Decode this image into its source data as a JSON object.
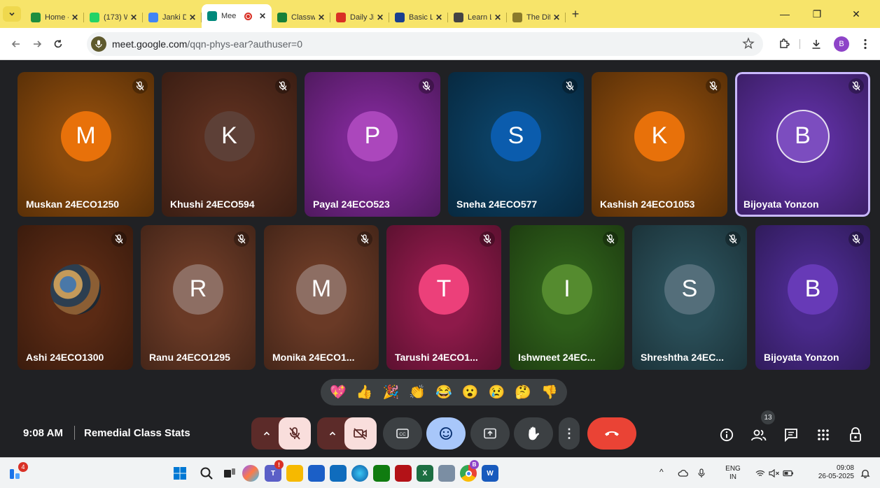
{
  "browser": {
    "tab_search_icon": "chevron-down-icon",
    "tabs": [
      {
        "title": "Home -",
        "icon": "drive-icon",
        "color": "#1e8e3e",
        "active": false
      },
      {
        "title": "(173) W",
        "icon": "whatsapp-icon",
        "color": "#25d366",
        "active": false
      },
      {
        "title": "Janki De",
        "icon": "calendar-icon",
        "color": "#4285f4",
        "active": false
      },
      {
        "title": "Mee",
        "icon": "meet-icon",
        "color": "#00897b",
        "active": true
      },
      {
        "title": "Classwo",
        "icon": "classroom-icon",
        "color": "#188038",
        "active": false
      },
      {
        "title": "Daily Jig",
        "icon": "jigsaw-icon",
        "color": "#d93025",
        "active": false
      },
      {
        "title": "Basic La",
        "icon": "letter-l-icon",
        "color": "#1a3f8f",
        "active": false
      },
      {
        "title": "Learn L",
        "icon": "learn-icon",
        "color": "#444444",
        "active": false
      },
      {
        "title": "The Diff",
        "icon": "chart-icon",
        "color": "#8a7a2a",
        "active": false
      }
    ],
    "new_tab_label": "+",
    "tab_close_glyph": "✕",
    "window_controls": {
      "minimize": "—",
      "restore": "❐",
      "close": "✕"
    },
    "url_host": "meet.google.com",
    "url_path": "/qqn-phys-ear?authuser=0",
    "profile_initial": "B"
  },
  "meet": {
    "participants": [
      {
        "name": "Muskan 24ECO1250",
        "initial": "M",
        "bg": "#8a4a0c",
        "avatar": "#e8710a"
      },
      {
        "name": "Khushi 24ECO594",
        "initial": "K",
        "bg": "#5a2e1e",
        "avatar": "#5d4037"
      },
      {
        "name": "Payal 24ECO523",
        "initial": "P",
        "bg": "#7b2792",
        "avatar": "#ab47bc"
      },
      {
        "name": "Sneha 24ECO577",
        "initial": "S",
        "bg": "#0b3f62",
        "avatar": "#0b5cad"
      },
      {
        "name": "Kashish 24ECO1053",
        "initial": "K",
        "bg": "#8a4a0c",
        "avatar": "#e8710a"
      },
      {
        "name": "Bijoyata Yonzon",
        "initial": "B",
        "bg": "#5b2e9c",
        "avatar": "#7c4dbf",
        "speaking": true
      },
      {
        "name": "Ashi 24ECO1300",
        "initial": "",
        "bg": "#5a2a14",
        "avatar": "#3a3a3a",
        "photo": true
      },
      {
        "name": "Ranu 24ECO1295",
        "initial": "R",
        "bg": "#6a3a26",
        "avatar": "#8d6e63"
      },
      {
        "name": "Monika 24ECO1...",
        "initial": "M",
        "bg": "#6a3a26",
        "avatar": "#8d6e63"
      },
      {
        "name": "Tarushi 24ECO1...",
        "initial": "T",
        "bg": "#8e1a4a",
        "avatar": "#ec407a"
      },
      {
        "name": "Ishwneet 24EC...",
        "initial": "I",
        "bg": "#2e5e1a",
        "avatar": "#558b2f"
      },
      {
        "name": "Shreshtha 24EC...",
        "initial": "S",
        "bg": "#2a4e58",
        "avatar": "#546e7a"
      },
      {
        "name": "Bijoyata Yonzon",
        "initial": "B",
        "bg": "#4a2a8c",
        "avatar": "#673ab7"
      }
    ],
    "reactions": [
      "💖",
      "👍",
      "🎉",
      "👏",
      "😂",
      "😮",
      "😢",
      "🤔",
      "👎"
    ],
    "clock": "9:08 AM",
    "meeting_name": "Remedial Class Stats",
    "participant_count": "13",
    "controls": {
      "more_options": "⋮",
      "hand": "✋",
      "captions": "CC"
    }
  },
  "taskbar": {
    "notification_count": "4",
    "teams_alert": "!",
    "chrome_badge": "B",
    "language": "ENG",
    "region": "IN",
    "time": "09:08",
    "date": "26-05-2025",
    "tray_caret": "^"
  },
  "colors": {
    "meet_bg": "#202124",
    "end_call": "#ea4335",
    "mic_off_bg": "#5c2b29",
    "control_bg": "#3c4043",
    "reaction_active": "#a8c7fa",
    "tab_strip": "#f7e46a"
  }
}
